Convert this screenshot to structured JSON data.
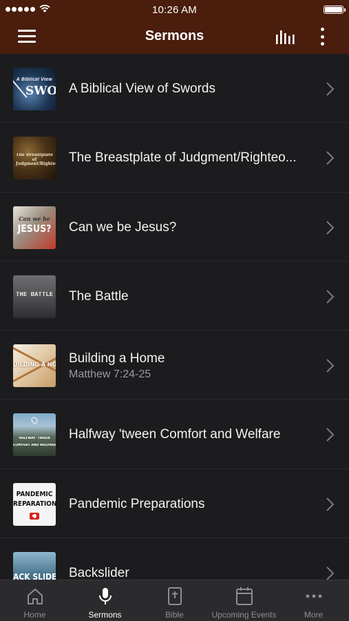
{
  "status_bar": {
    "time": "10:26 AM"
  },
  "nav": {
    "title": "Sermons"
  },
  "sermons": [
    {
      "title": "A Biblical View of Swords",
      "subtitle": "",
      "thumb_text": "SWOR",
      "thumb_small": "A Biblical View"
    },
    {
      "title": "The Breastplate of Judgment/Righteo...",
      "subtitle": "",
      "thumb_text": "",
      "thumb_small": "The Breastplate of Judgment/Righteousness"
    },
    {
      "title": "Can we be Jesus?",
      "subtitle": "",
      "thumb_text": "JESUS?",
      "thumb_small": "Can we be"
    },
    {
      "title": "The Battle",
      "subtitle": "",
      "thumb_text": "THE BATTLE",
      "thumb_small": ""
    },
    {
      "title": "Building a Home",
      "subtitle": "Matthew 7:24-25",
      "thumb_text": "UILDING A HO",
      "thumb_small": ""
    },
    {
      "title": "Halfway 'tween Comfort and Welfare",
      "subtitle": "",
      "thumb_text": "HALFWAY 'TWEEN",
      "thumb_small": "COMFORT AND WELFARE"
    },
    {
      "title": "Pandemic Preparations",
      "subtitle": "",
      "thumb_text": "PANDEMIC",
      "thumb_small": "REPARATION"
    },
    {
      "title": "Backslider",
      "subtitle": "",
      "thumb_text": "ACK SLIDE",
      "thumb_small": ""
    }
  ],
  "tabs": [
    {
      "label": "Home",
      "icon": "home-icon"
    },
    {
      "label": "Sermons",
      "icon": "microphone-icon"
    },
    {
      "label": "Bible",
      "icon": "bible-icon"
    },
    {
      "label": "Upcoming Events",
      "icon": "calendar-icon"
    },
    {
      "label": "More",
      "icon": "more-icon"
    }
  ],
  "colors": {
    "header": "#4a1d0c",
    "background": "#1c1c1e",
    "tab_bar": "#2b2b2d",
    "inactive_tab": "#8e8e93"
  }
}
